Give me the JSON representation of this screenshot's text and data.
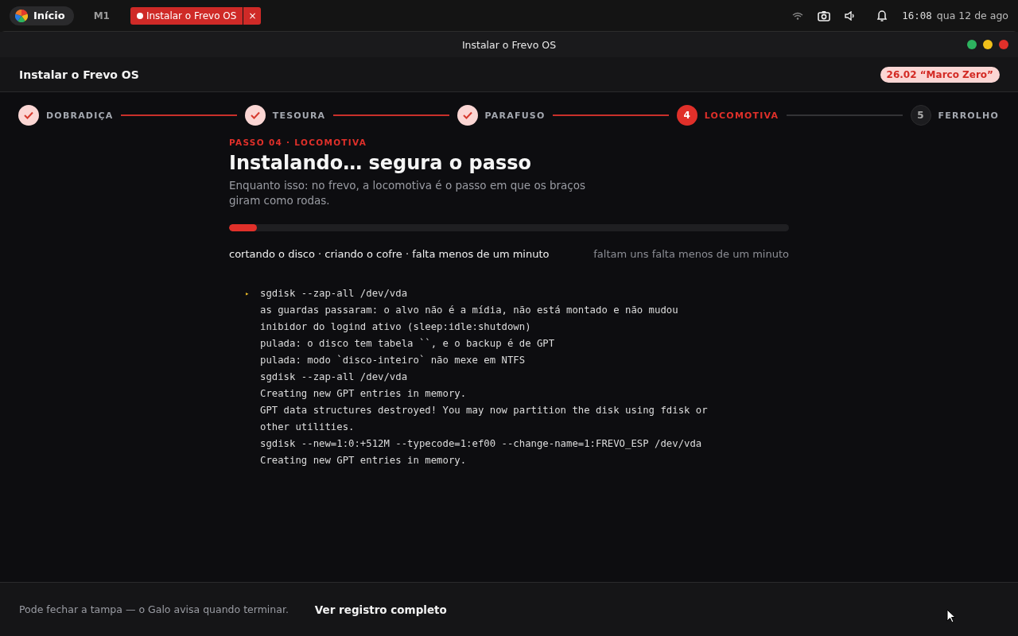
{
  "top_bar": {
    "start_button": "Início",
    "workspace": "M1",
    "task": {
      "label": "Instalar o Frevo OS",
      "close": "×"
    },
    "clock": "16:08",
    "date": "qua 12 de ago"
  },
  "window": {
    "title": "Instalar o Frevo OS"
  },
  "header": {
    "title": "Instalar o Frevo OS",
    "version_badge": "26.02 “Marco Zero”"
  },
  "steps": [
    {
      "label": "DOBRADIÇA",
      "done": true,
      "selected": false
    },
    {
      "label": "TESOURA",
      "done": true,
      "selected": false
    },
    {
      "label": "PARAFUSO",
      "done": true,
      "selected": false
    },
    {
      "label": "LOCOMOTIVA",
      "done": false,
      "selected": true,
      "number": "4"
    },
    {
      "label": "FERROLHO",
      "done": false,
      "selected": false,
      "number": "5"
    }
  ],
  "content": {
    "eyebrow": "PASSO 04 · LOCOMOTIVA",
    "title": "Instalando… segura o passo",
    "subtitle": "Enquanto isso: no frevo, a locomotiva é o passo em que os braços giram como rodas.",
    "progress": {
      "level": 0.05
    },
    "status": "cortando o disco · criando o cofre · falta menos de um minuto",
    "remaining": "faltam uns falta menos de um minuto"
  },
  "log": [
    {
      "text": "sgdisk --zap-all /dev/vda",
      "marker": "▸"
    },
    {
      "text": "as guardas passaram: o alvo não é a mídia, não está montado e não mudou"
    },
    {
      "text": "inibidor do logind ativo (sleep:idle:shutdown)"
    },
    {
      "text": "pulada: o disco tem tabela ``, e o backup é de GPT"
    },
    {
      "text": "pulada: modo `disco-inteiro` não mexe em NTFS"
    },
    {
      "text": "sgdisk --zap-all /dev/vda"
    },
    {
      "text": "Creating new GPT entries in memory."
    },
    {
      "text": "GPT data structures destroyed! You may now partition the disk using fdisk or other utilities."
    },
    {
      "text": "sgdisk --new=1:0:+512M --typecode=1:ef00 --change-name=1:FREVO_ESP /dev/vda"
    },
    {
      "text": "Creating new GPT entries in memory."
    }
  ],
  "footer": {
    "note": "Pode fechar a tampa — o Galo avisa quando terminar.",
    "link": "Ver registro completo"
  }
}
